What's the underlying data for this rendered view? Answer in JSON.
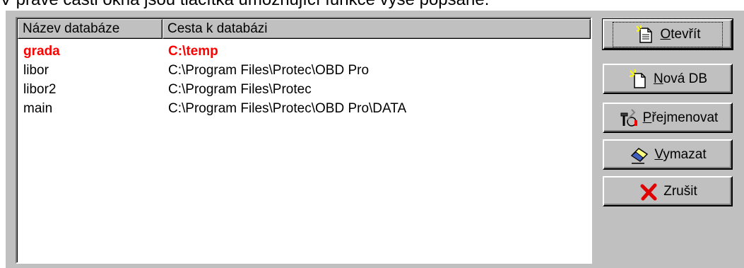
{
  "top_text": "V pravé části okna jsou tlačítka umožňující funkce výše popsané.",
  "list": {
    "columns": [
      "Název databáze",
      "Cesta k databázi"
    ],
    "rows": [
      {
        "name": "grada",
        "path": "C:\\temp",
        "highlight": true
      },
      {
        "name": "libor",
        "path": "C:\\Program Files\\Protec\\OBD Pro",
        "highlight": false
      },
      {
        "name": "libor2",
        "path": "C:\\Program Files\\Protec",
        "highlight": false
      },
      {
        "name": "main",
        "path": "C:\\Program Files\\Protec\\OBD Pro\\DATA",
        "highlight": false
      }
    ],
    "highlight_color": "#ff0000"
  },
  "buttons": {
    "open": {
      "label_pre": "",
      "accel": "O",
      "label_post": "tevřít",
      "icon": "open-document-icon"
    },
    "new": {
      "label_pre": "",
      "accel": "N",
      "label_post": "ová DB",
      "icon": "new-document-icon"
    },
    "rename": {
      "label_pre": "",
      "accel": "P",
      "label_post": "řejmenovat",
      "icon": "rename-tools-icon"
    },
    "delete": {
      "label_pre": "",
      "accel": "V",
      "label_post": "ymazat",
      "icon": "eraser-icon"
    },
    "cancel": {
      "label_pre": "",
      "accel": "",
      "label_post": "Zrušit",
      "icon": "red-x-icon"
    }
  },
  "colors": {
    "dialog_bg": "#c0c0c0",
    "window_bg": "#ffffff",
    "highlight": "#ff0000"
  }
}
